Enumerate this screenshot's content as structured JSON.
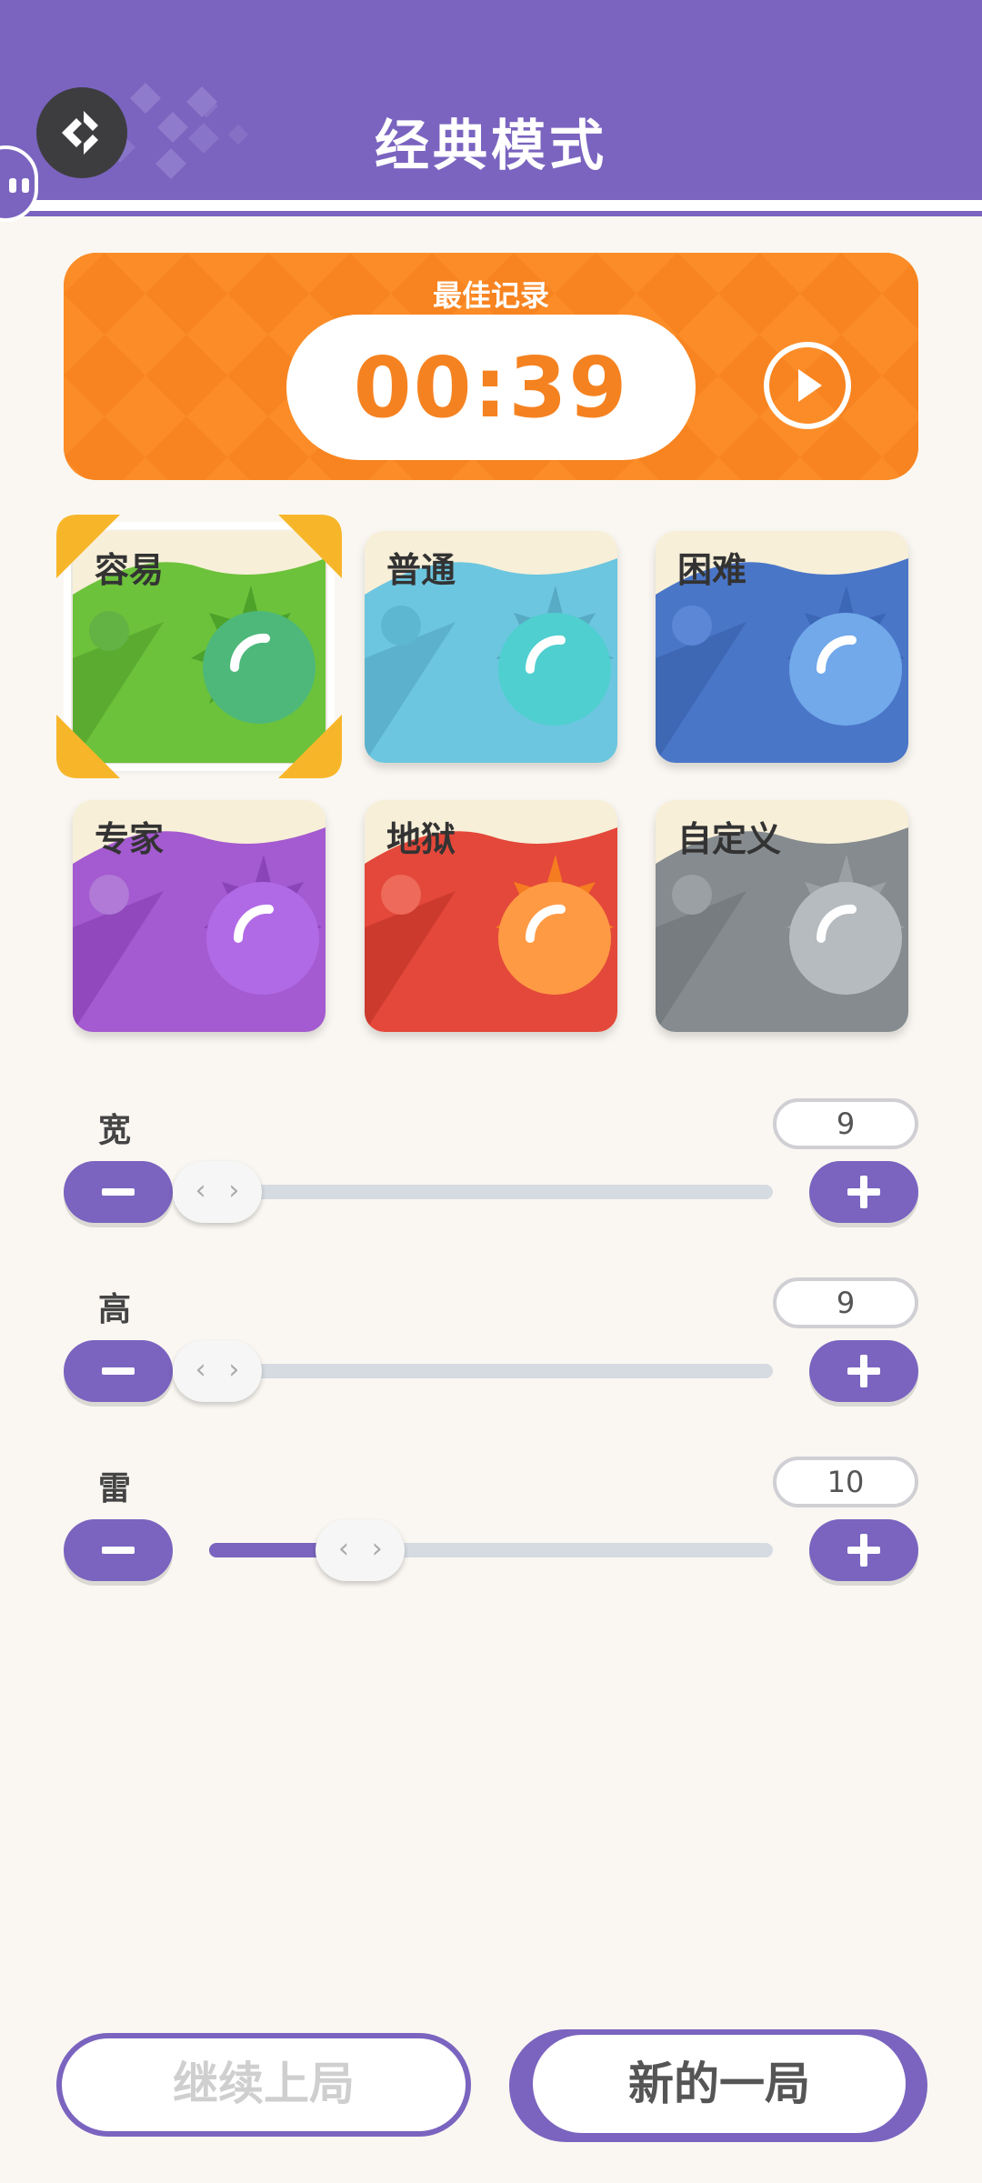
{
  "header": {
    "title": "经典模式",
    "back_icon": "back-arrow-icon",
    "bg_color": "#7a64bf"
  },
  "record": {
    "label": "最佳记录",
    "time": "00:39",
    "play_icon": "play-icon",
    "bg_color": "#fb8c27"
  },
  "difficulties": [
    {
      "label": "容易",
      "selected": true
    },
    {
      "label": "普通",
      "selected": false
    },
    {
      "label": "困难",
      "selected": false
    },
    {
      "label": "专家",
      "selected": false
    },
    {
      "label": "地狱",
      "selected": false
    },
    {
      "label": "自定义",
      "selected": false
    }
  ],
  "sliders": [
    {
      "label": "宽",
      "value": "9",
      "fraction": 0.0
    },
    {
      "label": "高",
      "value": "9",
      "fraction": 0.0
    },
    {
      "label": "雷",
      "value": "10",
      "fraction": 0.28
    }
  ],
  "buttons": {
    "continue": "继续上局",
    "new_game": "新的一局"
  }
}
